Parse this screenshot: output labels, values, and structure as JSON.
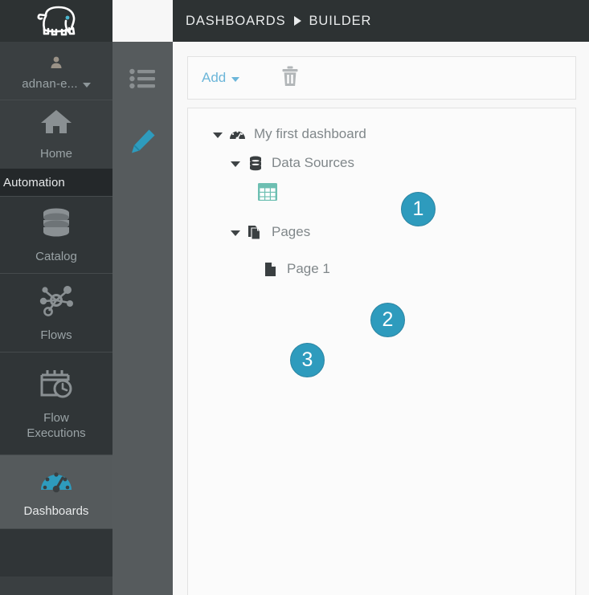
{
  "brand": {
    "logo_icon": "elephant-logo-icon",
    "logo_eye_color": "#4ab8d0"
  },
  "sidebar": {
    "user": {
      "icon": "user-icon",
      "name": "adnan-e...",
      "caret_icon": "chevron-down-icon"
    },
    "items": [
      {
        "label": "Home",
        "icon": "home-icon",
        "state": "normal"
      }
    ],
    "section_label": "Automation",
    "automation_items": [
      {
        "label": "Catalog",
        "icon": "database-icon",
        "state": "normal"
      },
      {
        "label": "Flows",
        "icon": "flows-network-icon",
        "state": "normal"
      },
      {
        "label": "Flow\nExecutions",
        "label_line1": "Flow",
        "label_line2": "Executions",
        "icon": "calendar-clock-icon",
        "state": "normal"
      },
      {
        "label": "Dashboards",
        "icon": "dashboard-gauge-icon",
        "state": "active"
      }
    ]
  },
  "icon_column": {
    "buttons": [
      {
        "icon": "list-outline-icon",
        "color": "#8a8f91"
      },
      {
        "icon": "pencil-edit-icon",
        "color": "#2e9bbd"
      }
    ]
  },
  "header": {
    "breadcrumb": {
      "root": "DASHBOARDS",
      "separator_icon": "triangle-right-icon",
      "current": "BUILDER"
    }
  },
  "toolbar": {
    "add_label": "Add",
    "add_caret_icon": "chevron-down-icon",
    "delete_icon": "trash-icon"
  },
  "tree": {
    "nodes": [
      {
        "label": "My first dashboard",
        "icon": "dashboard-gauge-icon",
        "caret_icon": "caret-down-icon",
        "level": 0
      },
      {
        "label": "Data Sources",
        "icon": "database-icon",
        "caret_icon": "caret-down-icon",
        "level": 1
      },
      {
        "label": "",
        "icon": "table-grid-icon",
        "level": 2
      },
      {
        "label": "Pages",
        "icon": "pages-stack-icon",
        "caret_icon": "caret-down-icon",
        "level": 1
      },
      {
        "label": "Page 1",
        "icon": "page-file-icon",
        "level": 2
      }
    ]
  },
  "annotations": {
    "badges": [
      {
        "number": "1"
      },
      {
        "number": "2"
      },
      {
        "number": "3"
      }
    ],
    "color": "#2e9bbd"
  }
}
